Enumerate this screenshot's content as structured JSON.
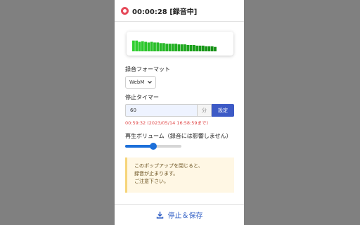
{
  "header": {
    "timer": "00:00:28 [録音中]",
    "icon": "record-icon",
    "accent": "#e64a5a"
  },
  "visualizer": {
    "levels": [
      0.85,
      0.85,
      0.75,
      0.8,
      0.75,
      0.7,
      0.75,
      0.7,
      0.7,
      0.65,
      0.65,
      0.6,
      0.6,
      0.6,
      0.6,
      0.55,
      0.55,
      0.55,
      0.5,
      0.5,
      0.5,
      0.45,
      0.45,
      0.45,
      0.4,
      0.4,
      0.4,
      0.35
    ],
    "color": "#2fcf2f"
  },
  "format": {
    "label": "録音フォーマット",
    "value": "WebM"
  },
  "stop_timer": {
    "label": "停止タイマー",
    "value": "60",
    "unit": "分",
    "set_label": "設定",
    "stop_time": "00:59:32 (2023/05/14 16:58:59まで)"
  },
  "volume": {
    "label": "再生ボリューム（録音には影響しません）",
    "level": 0.5
  },
  "notice": {
    "lines": [
      "このポップアップを閉じると、",
      "録音が止まります。",
      "ご注意下さい。"
    ]
  },
  "footer": {
    "action_label": "停止＆保存",
    "icon": "download-icon"
  }
}
